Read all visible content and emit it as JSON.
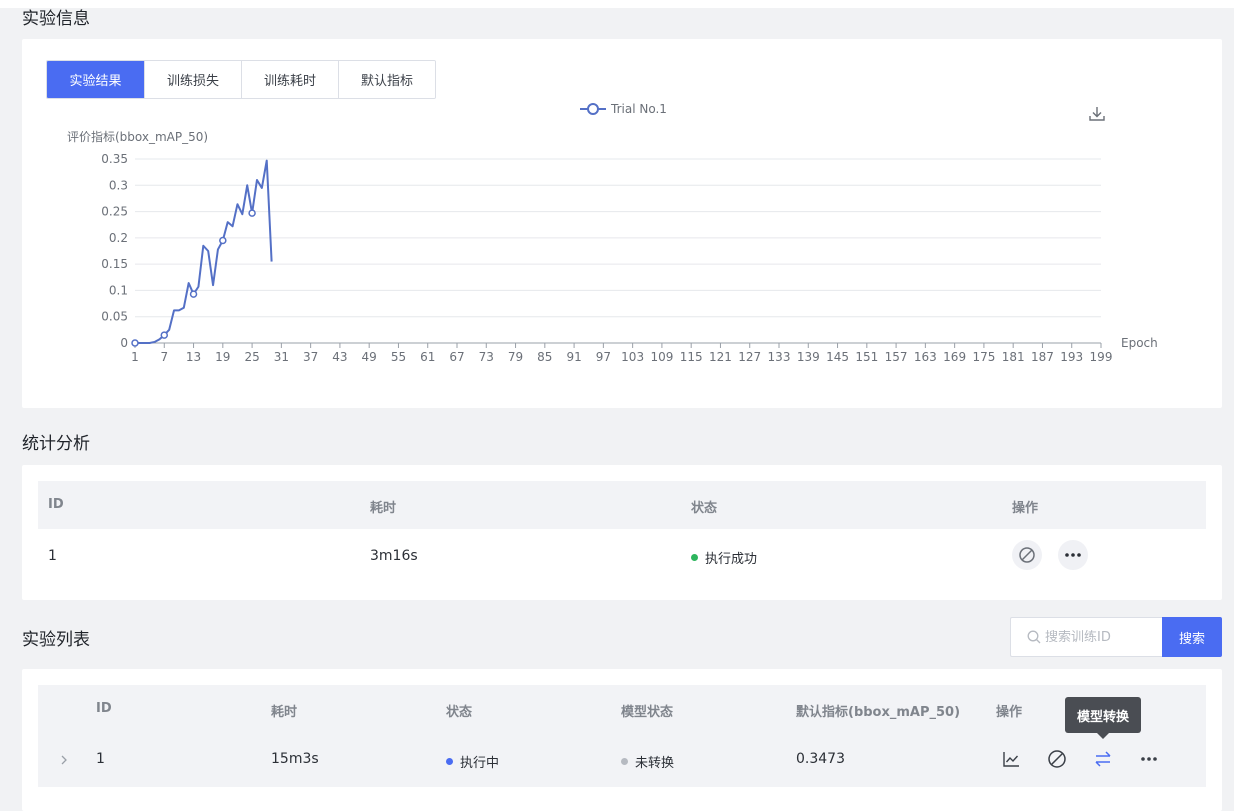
{
  "experiment_info": {
    "title": "实验信息",
    "tabs": [
      "实验结果",
      "训练损失",
      "训练耗时",
      "默认指标"
    ],
    "active_tab": "实验结果",
    "download_icon": "download-icon"
  },
  "chart_data": {
    "type": "line",
    "ylabel": "评价指标(bbox_mAP_50)",
    "xlabel": "Epoch",
    "legend_position": "top-center",
    "grid": true,
    "ylim": [
      0,
      0.35
    ],
    "xlim": [
      1,
      199
    ],
    "x_ticks": [
      "1",
      "7",
      "13",
      "19",
      "25",
      "31",
      "37",
      "43",
      "49",
      "55",
      "61",
      "67",
      "73",
      "79",
      "85",
      "91",
      "97",
      "103",
      "109",
      "115",
      "121",
      "127",
      "133",
      "139",
      "145",
      "151",
      "157",
      "163",
      "169",
      "175",
      "181",
      "187",
      "193",
      "199"
    ],
    "y_ticks": [
      "0",
      "0.05",
      "0.1",
      "0.15",
      "0.2",
      "0.25",
      "0.3",
      "0.35"
    ],
    "series": [
      {
        "name": "Trial No.1",
        "color": "#5470c6",
        "x": [
          1,
          2,
          3,
          4,
          5,
          6,
          7,
          8,
          9,
          10,
          11,
          12,
          13,
          14,
          15,
          16,
          17,
          18,
          19,
          20,
          21,
          22,
          23,
          24,
          25,
          26,
          27,
          28,
          29
        ],
        "y": [
          0,
          0,
          0,
          0,
          0.002,
          0.007,
          0.015,
          0.025,
          0.062,
          0.062,
          0.067,
          0.114,
          0.093,
          0.107,
          0.185,
          0.175,
          0.11,
          0.178,
          0.195,
          0.23,
          0.222,
          0.264,
          0.245,
          0.3,
          0.247,
          0.31,
          0.295,
          0.347,
          0.155
        ],
        "markers_at": [
          1,
          7,
          13,
          19,
          25
        ]
      }
    ]
  },
  "stats": {
    "title": "统计分析",
    "headers": [
      "ID",
      "耗时",
      "状态",
      "操作"
    ],
    "row": {
      "id": "1",
      "duration": "3m16s",
      "status": "执行成功",
      "status_color": "#2db55d"
    }
  },
  "experiment_list": {
    "title": "实验列表",
    "search_placeholder": "搜索训练ID",
    "search_button": "搜索",
    "headers": [
      "ID",
      "耗时",
      "状态",
      "模型状态",
      "默认指标(bbox_mAP_50)",
      "操作"
    ],
    "row": {
      "id": "1",
      "duration": "15m3s",
      "status": "执行中",
      "status_color": "#4a6cf2",
      "model_status": "未转换",
      "model_status_color": "#b6bac1",
      "metric": "0.3473"
    },
    "tooltip": "模型转换"
  }
}
